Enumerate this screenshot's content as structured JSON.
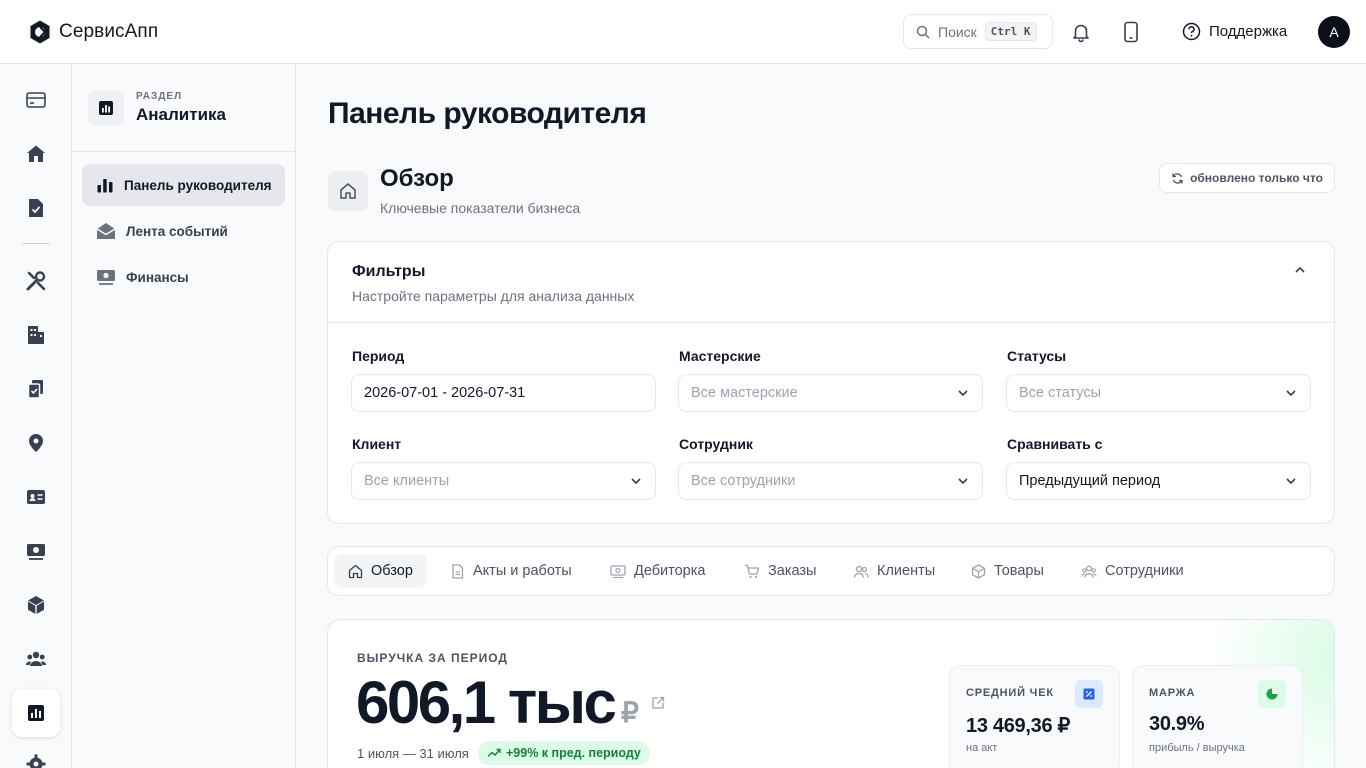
{
  "app": {
    "name": "СервисАпп"
  },
  "header": {
    "search_label": "Поиск",
    "search_kbd": "Ctrl K",
    "support_label": "Поддержка",
    "avatar_initial": "A"
  },
  "rail": {
    "icons": [
      "card-icon",
      "home-icon",
      "document-check-icon",
      "tools-icon",
      "building-icon",
      "clipboard-check-icon",
      "location-pin-icon",
      "id-card-icon",
      "cash-icon",
      "cube-icon",
      "users-icon",
      "chart-bar-icon",
      "settings-icon"
    ],
    "active": "chart-bar-icon"
  },
  "section": {
    "overline": "РАЗДЕЛ",
    "title": "Аналитика",
    "items": [
      {
        "label": "Панель руководителя",
        "icon": "chart-bar-icon",
        "active": true
      },
      {
        "label": "Лента событий",
        "icon": "envelope-open-icon",
        "active": false
      },
      {
        "label": "Финансы",
        "icon": "cash-icon",
        "active": false
      }
    ]
  },
  "page": {
    "title": "Панель руководителя",
    "overview_title": "Обзор",
    "overview_subtitle": "Ключевые показатели бизнеса",
    "refresh_label": "обновлено только что"
  },
  "filters": {
    "title": "Фильтры",
    "subtitle": "Настройте параметры для анализа данных",
    "fields": [
      {
        "label": "Период",
        "value": "2026-07-01 - 2026-07-31",
        "placeholder": ""
      },
      {
        "label": "Мастерские",
        "value": "",
        "placeholder": "Все мастерские"
      },
      {
        "label": "Статусы",
        "value": "",
        "placeholder": "Все статусы"
      },
      {
        "label": "Клиент",
        "value": "",
        "placeholder": "Все клиенты"
      },
      {
        "label": "Сотрудник",
        "value": "",
        "placeholder": "Все сотрудники"
      },
      {
        "label": "Сравнивать с",
        "value": "Предыдущий период",
        "placeholder": ""
      }
    ]
  },
  "tabs": [
    {
      "label": "Обзор",
      "icon": "home-icon",
      "active": true
    },
    {
      "label": "Акты и работы",
      "icon": "document-icon",
      "active": false
    },
    {
      "label": "Дебиторка",
      "icon": "cash-icon",
      "active": false
    },
    {
      "label": "Заказы",
      "icon": "cart-icon",
      "active": false
    },
    {
      "label": "Клиенты",
      "icon": "users-icon",
      "active": false
    },
    {
      "label": "Товары",
      "icon": "cube-icon",
      "active": false
    },
    {
      "label": "Сотрудники",
      "icon": "users-group-icon",
      "active": false
    }
  ],
  "revenue": {
    "label": "ВЫРУЧКА ЗА ПЕРИОД",
    "value": "606,1 тыс",
    "currency": "₽",
    "range": "1 июля — 31 июля",
    "change": "+99% к пред. периоду"
  },
  "kpis": [
    {
      "label": "СРЕДНИЙ ЧЕК",
      "value": "13 469,36 ₽",
      "note": "на акт",
      "icon": "receipt-icon",
      "accent": "#2563eb",
      "bg": "#dbeafe"
    },
    {
      "label": "МАРЖА",
      "value": "30.9%",
      "note": "прибыль / выручка",
      "icon": "pie-chart-icon",
      "accent": "#16a34a",
      "bg": "#dcfce7"
    }
  ],
  "colors": {
    "accent_green": "#15803d",
    "dark": "#0b0f19"
  }
}
